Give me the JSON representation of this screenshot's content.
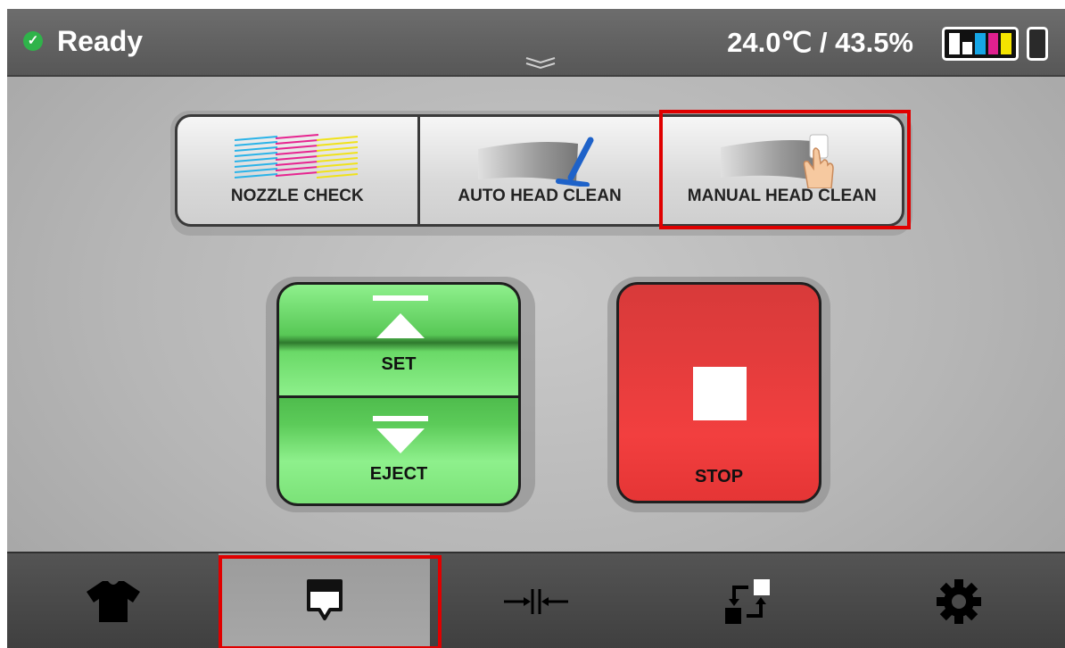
{
  "status": {
    "icon": "check-circle-icon",
    "text": "Ready",
    "environment": "24.0℃ / 43.5%",
    "ink_icon": "ink-level-icon",
    "ink_colors": [
      "#ffffff",
      "#ffffff",
      "#16a6e6",
      "#e0208f",
      "#f4e400"
    ],
    "waste_icon": "waste-ink-icon",
    "pull_handle_icon": "double-chevron-down-icon"
  },
  "maintenance": {
    "buttons": [
      {
        "label": "NOZZLE CHECK",
        "icon": "nozzle-check-pattern-icon"
      },
      {
        "label": "AUTO HEAD CLEAN",
        "icon": "wiper-icon"
      },
      {
        "label": "MANUAL HEAD CLEAN",
        "icon": "hand-wipe-icon",
        "highlighted": true
      }
    ]
  },
  "feed": {
    "set_label": "SET",
    "eject_label": "EJECT",
    "set_icon": "up-arrow-icon",
    "eject_icon": "down-arrow-icon"
  },
  "stop": {
    "label": "STOP",
    "icon": "stop-square-icon"
  },
  "nav": {
    "tabs": [
      {
        "icon": "tshirt-icon",
        "active": false
      },
      {
        "icon": "maintenance-icon",
        "active": true,
        "highlighted": true
      },
      {
        "icon": "align-center-icon",
        "active": false
      },
      {
        "icon": "replace-icon",
        "active": false
      },
      {
        "icon": "gear-icon",
        "active": false
      }
    ]
  },
  "colors": {
    "highlight": "#e00000",
    "green_button": "#8ef08c",
    "red_button": "#e23c3c",
    "status_ok": "#2fb34a"
  }
}
